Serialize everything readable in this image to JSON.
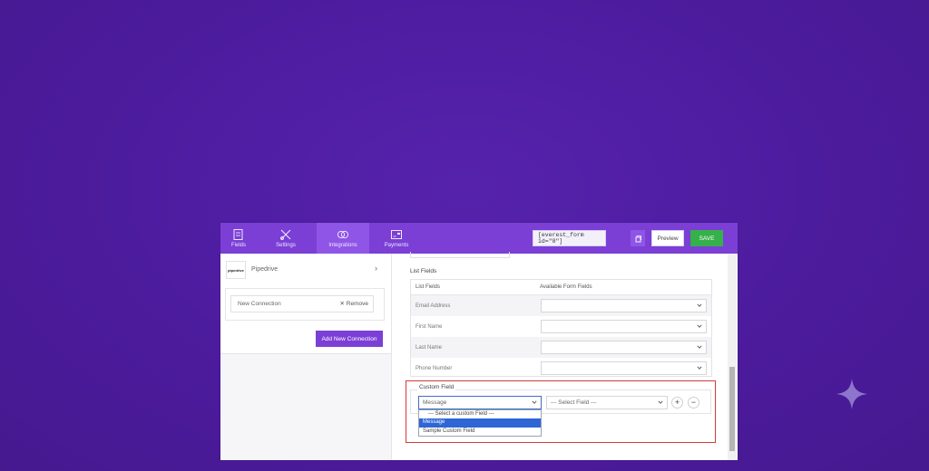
{
  "topbar": {
    "tabs": [
      {
        "label": "Fields",
        "icon": "fields-icon"
      },
      {
        "label": "Settings",
        "icon": "settings-icon"
      },
      {
        "label": "Integrations",
        "icon": "integrations-icon"
      },
      {
        "label": "Payments",
        "icon": "payments-icon"
      }
    ],
    "active_tab": "Integrations",
    "shortcode": "[everest_form id=\"8\"]",
    "preview_label": "Preview",
    "save_label": "SAVE"
  },
  "sidebar": {
    "logo_text": "pipedrive",
    "integration_name": "Pipedrive",
    "connection_name": "New Connection",
    "remove_label": "Remove",
    "add_connection_label": "Add New Connection"
  },
  "main": {
    "list_fields_title": "List Fields",
    "table_headers": [
      "List Fields",
      "Available Form Fields"
    ],
    "rows": [
      {
        "label": "Email Address",
        "value": ""
      },
      {
        "label": "First Name",
        "value": ""
      },
      {
        "label": "Last Name",
        "value": ""
      },
      {
        "label": "Phone Number",
        "value": ""
      }
    ],
    "custom_field": {
      "title": "Custom Field",
      "selected_value": "Message",
      "select_field_placeholder": "--- Select Field ---",
      "dropdown_options": [
        "--- Select a custom Field ---",
        "Message",
        "Sample Custom Field"
      ],
      "highlighted_option": "Message"
    }
  },
  "colors": {
    "page_background": "#4f1ea3",
    "topbar": "#7b3fd6",
    "save_button": "#35b04a",
    "highlight_border": "#d43a3a",
    "selected_option": "#2f66d6"
  }
}
